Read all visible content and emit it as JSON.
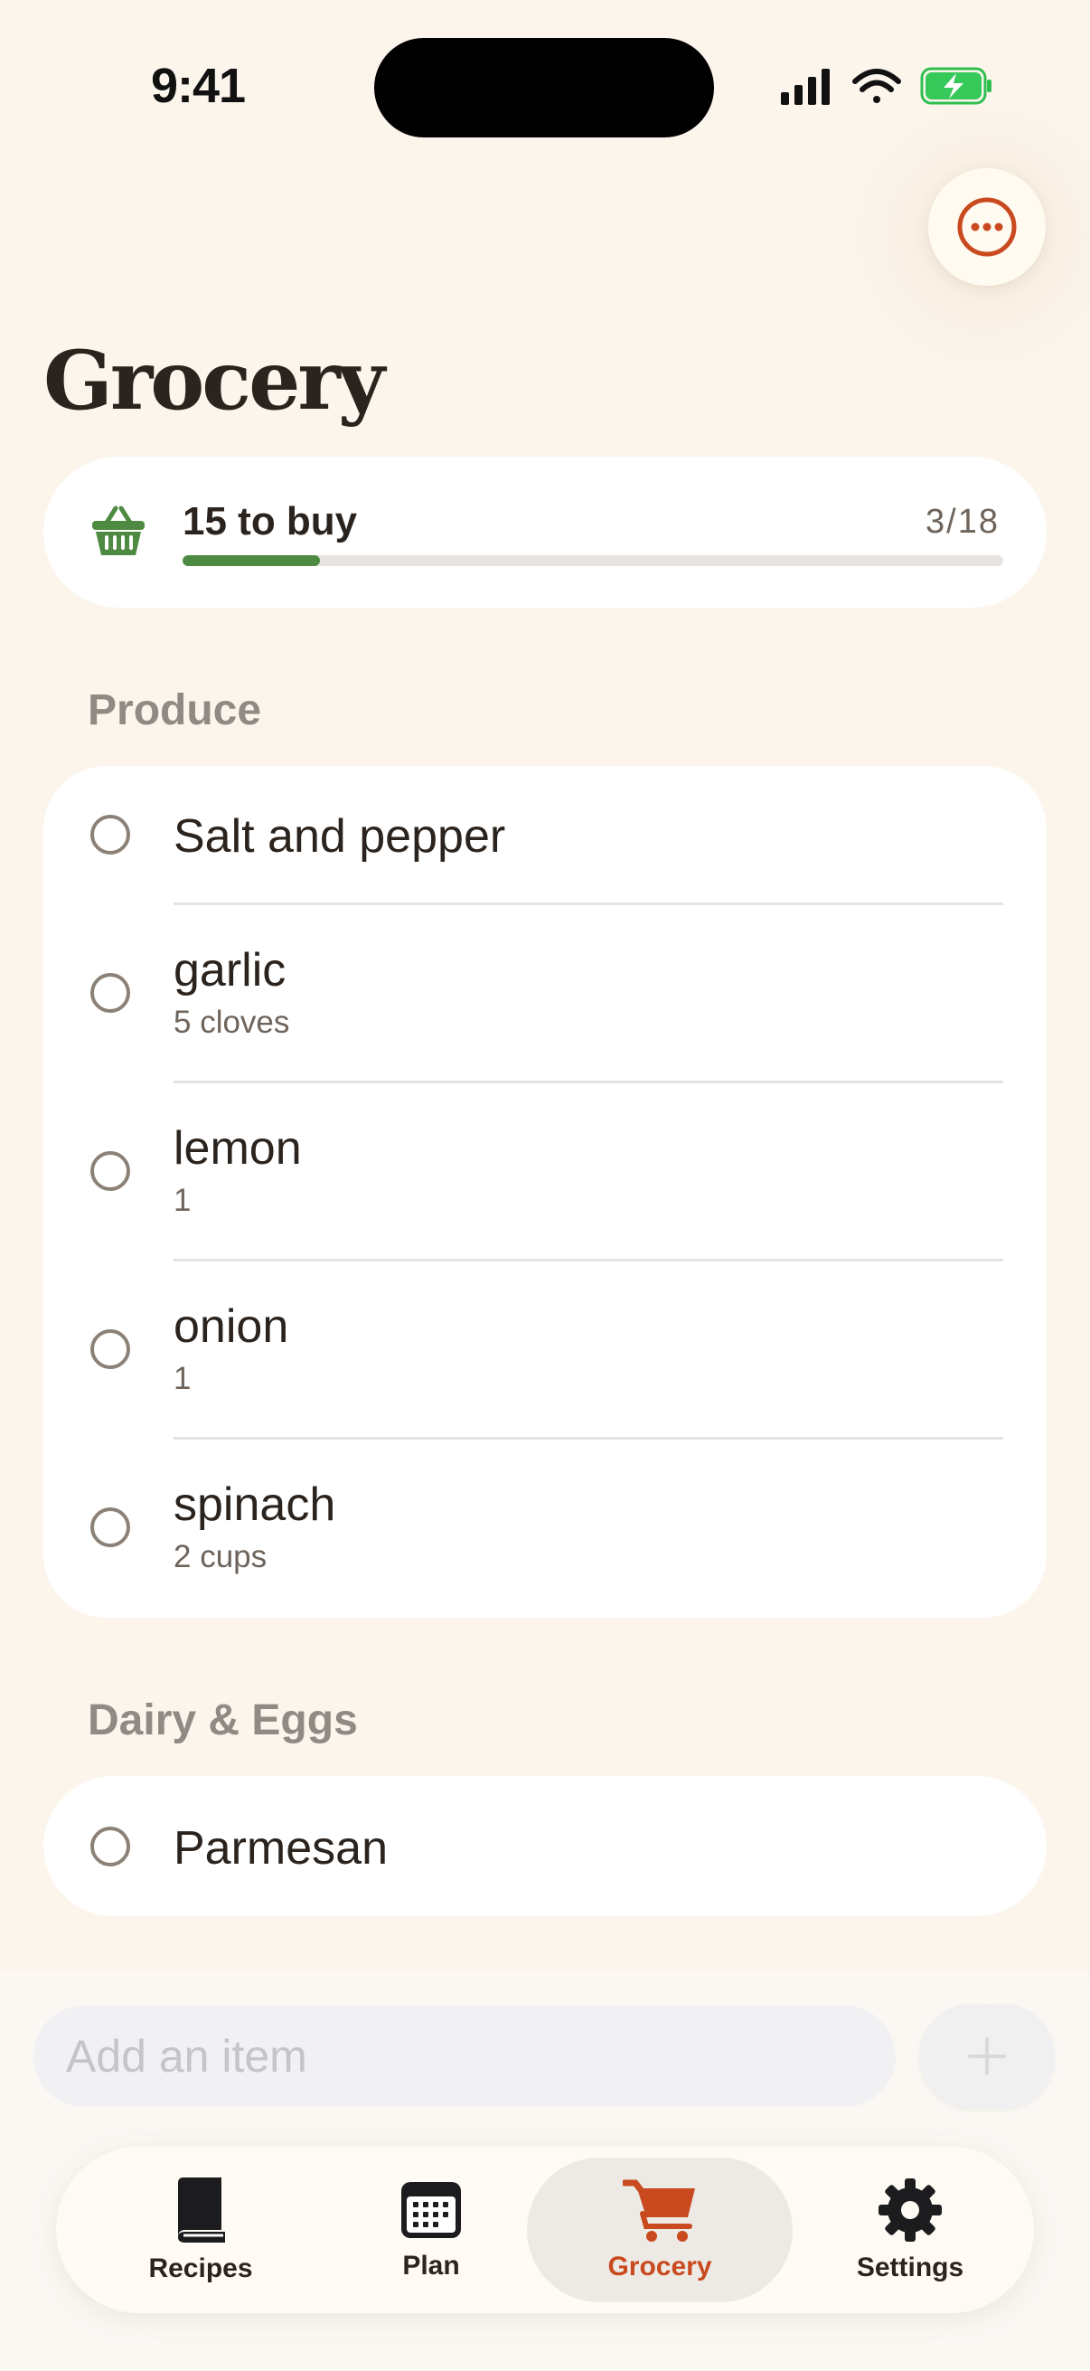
{
  "status_bar": {
    "time": "9:41"
  },
  "page": {
    "title": "Grocery"
  },
  "summary": {
    "label": "15 to buy",
    "count": "3/18",
    "progress": 0.167,
    "accent": "#4E8A42"
  },
  "sections": [
    {
      "title": "Produce",
      "items": [
        {
          "name": "Salt and pepper",
          "qty": ""
        },
        {
          "name": "garlic",
          "qty": "5 cloves"
        },
        {
          "name": "lemon",
          "qty": "1"
        },
        {
          "name": "onion",
          "qty": "1"
        },
        {
          "name": "spinach",
          "qty": "2 cups"
        }
      ]
    },
    {
      "title": "Dairy & Eggs",
      "items": [
        {
          "name": "Parmesan",
          "qty": ""
        }
      ]
    }
  ],
  "add_item": {
    "placeholder": "Add an item"
  },
  "tabs": [
    {
      "label": "Recipes",
      "icon": "book-icon"
    },
    {
      "label": "Plan",
      "icon": "calendar-icon"
    },
    {
      "label": "Grocery",
      "icon": "cart-icon",
      "active": true
    },
    {
      "label": "Settings",
      "icon": "gear-icon"
    }
  ],
  "colors": {
    "accent": "#C94A1E",
    "background": "#FCF5EC"
  }
}
